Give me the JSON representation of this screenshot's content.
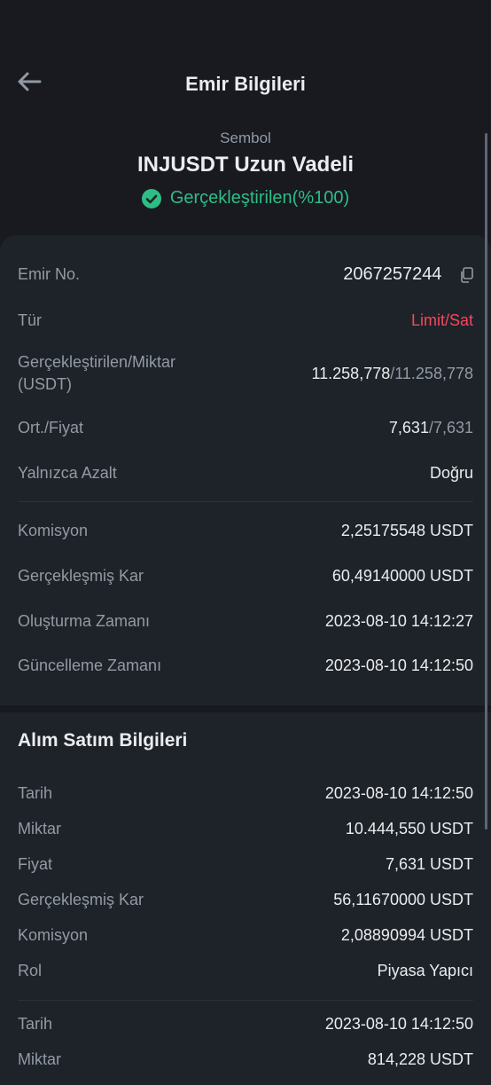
{
  "header": {
    "title": "Emir Bilgileri"
  },
  "symbol": {
    "label": "Sembol",
    "name": "INJUSDT Uzun Vadeli",
    "status": "Gerçekleştirilen(%100)"
  },
  "order": {
    "order_no_label": "Emir No.",
    "order_no": "2067257244",
    "type_label": "Tür",
    "type": "Limit/Sat",
    "filled_label_1": "Gerçekleştirilen/Miktar",
    "filled_label_2": "(USDT)",
    "filled": "11.258,778",
    "amount": "/11.258,778",
    "avg_label": "Ort./Fiyat",
    "avg": "7,631",
    "price": "/7,631",
    "reduce_label": "Yalnızca Azalt",
    "reduce": "Doğru",
    "fee_label": "Komisyon",
    "fee": "2,25175548 USDT",
    "pnl_label": "Gerçekleşmiş Kar",
    "pnl": "60,49140000 USDT",
    "created_label": "Oluşturma Zamanı",
    "created": "2023-08-10 14:12:27",
    "updated_label": "Güncelleme Zamanı",
    "updated": "2023-08-10 14:12:50"
  },
  "trades": {
    "title": "Alım Satım Bilgileri",
    "items": [
      {
        "date_label": "Tarih",
        "date": "2023-08-10 14:12:50",
        "qty_label": "Miktar",
        "qty": "10.444,550 USDT",
        "price_label": "Fiyat",
        "price": "7,631 USDT",
        "pnl_label": "Gerçekleşmiş Kar",
        "pnl": "56,11670000 USDT",
        "fee_label": "Komisyon",
        "fee": "2,08890994 USDT",
        "role_label": "Rol",
        "role": "Piyasa Yapıcı"
      },
      {
        "date_label": "Tarih",
        "date": "2023-08-10 14:12:50",
        "qty_label": "Miktar",
        "qty": "814,228 USDT"
      }
    ]
  },
  "colors": {
    "background": "#181a20",
    "card": "#1e2329",
    "green": "#2ebd85",
    "red": "#f6465d",
    "muted": "#929aa5"
  },
  "icons": {
    "back": "arrow-left-icon",
    "status": "check-circle-icon",
    "copy": "copy-icon"
  }
}
